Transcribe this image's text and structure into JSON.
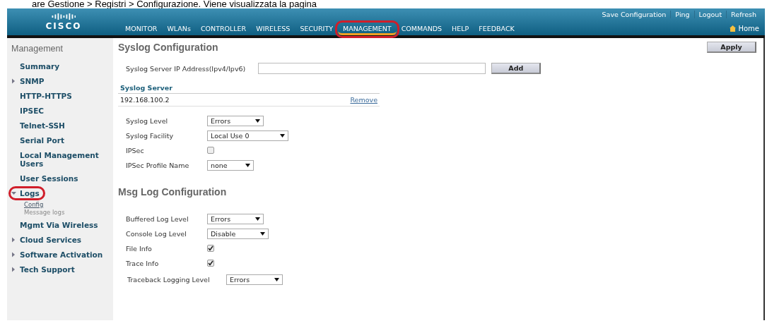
{
  "caption": "are Gestione > Registri > Configurazione. Viene visualizzata la pagina",
  "header": {
    "logo": "CISCO",
    "top_links": [
      "Save Configuration",
      "Ping",
      "Logout",
      "Refresh"
    ],
    "nav": [
      {
        "label": "MONITOR",
        "selected": false,
        "highlighted": false
      },
      {
        "label": "WLANs",
        "selected": false,
        "highlighted": false
      },
      {
        "label": "CONTROLLER",
        "selected": false,
        "highlighted": false
      },
      {
        "label": "WIRELESS",
        "selected": false,
        "highlighted": false
      },
      {
        "label": "SECURITY",
        "selected": false,
        "highlighted": false
      },
      {
        "label": "MANAGEMENT",
        "selected": true,
        "highlighted": true
      },
      {
        "label": "COMMANDS",
        "selected": false,
        "highlighted": false
      },
      {
        "label": "HELP",
        "selected": false,
        "highlighted": false
      },
      {
        "label": "FEEDBACK",
        "selected": false,
        "highlighted": false
      }
    ],
    "home": "Home"
  },
  "sidebar": {
    "title": "Management",
    "items": [
      {
        "label": "Summary",
        "expandable": false,
        "highlighted": false
      },
      {
        "label": "SNMP",
        "expandable": true,
        "expanded": false,
        "highlighted": false
      },
      {
        "label": "HTTP-HTTPS",
        "expandable": false,
        "highlighted": false
      },
      {
        "label": "IPSEC",
        "expandable": false,
        "highlighted": false
      },
      {
        "label": "Telnet-SSH",
        "expandable": false,
        "highlighted": false
      },
      {
        "label": "Serial Port",
        "expandable": false,
        "highlighted": false
      },
      {
        "label": "Local Management Users",
        "expandable": false,
        "highlighted": false
      },
      {
        "label": "User Sessions",
        "expandable": false,
        "highlighted": false
      },
      {
        "label": "Logs",
        "expandable": true,
        "expanded": true,
        "highlighted": true,
        "children": [
          {
            "label": "Config",
            "selected": true
          },
          {
            "label": "Message logs",
            "selected": false
          }
        ]
      },
      {
        "label": "Mgmt Via Wireless",
        "expandable": false,
        "highlighted": false
      },
      {
        "label": "Cloud Services",
        "expandable": true,
        "expanded": false,
        "highlighted": false
      },
      {
        "label": "Software Activation",
        "expandable": true,
        "expanded": false,
        "highlighted": false
      },
      {
        "label": "Tech Support",
        "expandable": true,
        "expanded": false,
        "highlighted": false
      }
    ]
  },
  "page": {
    "title": "Syslog Configuration",
    "apply": "Apply",
    "server_field": {
      "label": "Syslog Server IP Address(Ipv4/Ipv6)"
    },
    "add": "Add",
    "server_table": {
      "heading": "Syslog Server",
      "rows": [
        {
          "address": "192.168.100.2",
          "action": "Remove"
        }
      ]
    },
    "syslog_fields": [
      {
        "kind": "select",
        "label": "Syslog Level",
        "value": "Errors"
      },
      {
        "kind": "select",
        "label": "Syslog Facility",
        "value": "Local Use 0"
      },
      {
        "kind": "checkbox",
        "label": "IPSec",
        "checked": false
      },
      {
        "kind": "select",
        "label": "IPSec Profile Name",
        "value": "none"
      }
    ],
    "msg_title": "Msg Log Configuration",
    "msg_fields": [
      {
        "kind": "select",
        "label": "Buffered Log Level",
        "value": "Errors"
      },
      {
        "kind": "select",
        "label": "Console Log Level",
        "value": "Disable"
      },
      {
        "kind": "checkbox",
        "label": "File Info",
        "checked": true
      },
      {
        "kind": "checkbox",
        "label": "Trace Info",
        "checked": true
      },
      {
        "kind": "select",
        "label": "Traceback Logging Level",
        "value": "Errors"
      }
    ]
  }
}
